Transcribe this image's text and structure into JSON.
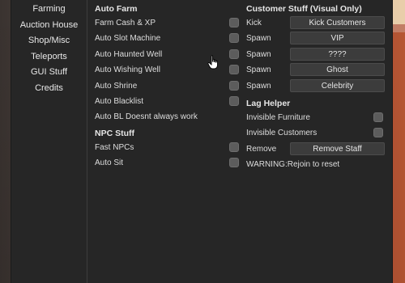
{
  "sidebar": {
    "items": [
      {
        "label": "Farming"
      },
      {
        "label": "Auction House"
      },
      {
        "label": "Shop/Misc"
      },
      {
        "label": "Teleports"
      },
      {
        "label": "GUI Stuff"
      },
      {
        "label": "Credits"
      }
    ]
  },
  "left": {
    "auto_farm_title": "Auto Farm",
    "auto_farm_rows": [
      {
        "label": "Farm Cash & XP",
        "checked": false
      },
      {
        "label": "Auto Slot Machine",
        "checked": false
      },
      {
        "label": "Auto Haunted Well",
        "checked": false
      },
      {
        "label": "Auto Wishing Well",
        "checked": false
      },
      {
        "label": "Auto Shrine",
        "checked": false
      },
      {
        "label": "Auto Blacklist",
        "checked": false
      }
    ],
    "note": "Auto BL Doesnt always work",
    "npc_title": "NPC Stuff",
    "npc_rows": [
      {
        "label": "Fast NPCs",
        "checked": false
      },
      {
        "label": "Auto Sit",
        "checked": false
      }
    ]
  },
  "right": {
    "customer_title": "Customer Stuff (Visual Only)",
    "customer_rows": [
      {
        "label": "Kick",
        "button": "Kick Customers"
      },
      {
        "label": "Spawn",
        "button": "VIP"
      },
      {
        "label": "Spawn",
        "button": "????"
      },
      {
        "label": "Spawn",
        "button": "Ghost"
      },
      {
        "label": "Spawn",
        "button": "Celebrity"
      }
    ],
    "lag_title": "Lag Helper",
    "lag_rows": [
      {
        "label": "Invisible Furniture",
        "checked": false
      },
      {
        "label": "Invisible Customers",
        "checked": false
      }
    ],
    "remove_label": "Remove",
    "remove_button": "Remove Staff",
    "warning": "WARNING:Rejoin to reset"
  },
  "colors": {
    "panel": "#262626",
    "button": "#3c3c3c",
    "checkbox": "#5c5c5c",
    "text": "#dedede"
  }
}
